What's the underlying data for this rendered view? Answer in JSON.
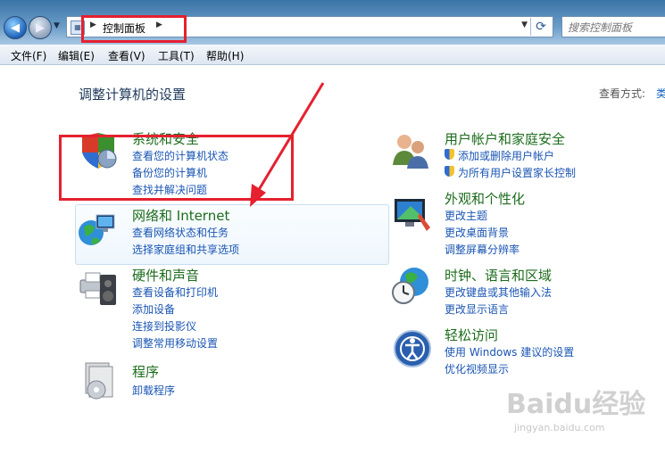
{
  "window": {
    "address_crumb": "控制面板",
    "search_placeholder": "搜索控制面板"
  },
  "menu": [
    "文件(F)",
    "编辑(E)",
    "查看(V)",
    "工具(T)",
    "帮助(H)"
  ],
  "page": {
    "title": "调整计算机的设置",
    "view_label": "查看方式:",
    "view_value": "类"
  },
  "categories": {
    "system_security": {
      "title": "系统和安全",
      "links": [
        "查看您的计算机状态",
        "备份您的计算机",
        "查找并解决问题"
      ]
    },
    "network": {
      "title": "网络和 Internet",
      "links": [
        "查看网络状态和任务",
        "选择家庭组和共享选项"
      ]
    },
    "hardware": {
      "title": "硬件和声音",
      "links": [
        "查看设备和打印机",
        "添加设备",
        "连接到投影仪",
        "调整常用移动设置"
      ]
    },
    "programs": {
      "title": "程序",
      "links": [
        "卸载程序"
      ]
    },
    "user_accounts": {
      "title": "用户帐户和家庭安全",
      "links": [
        "添加或删除用户帐户",
        "为所有用户设置家长控制"
      ]
    },
    "appearance": {
      "title": "外观和个性化",
      "links": [
        "更改主题",
        "更改桌面背景",
        "调整屏幕分辨率"
      ]
    },
    "clock_region": {
      "title": "时钟、语言和区域",
      "links": [
        "更改键盘或其他输入法",
        "更改显示语言"
      ]
    },
    "ease_access": {
      "title": "轻松访问",
      "links": [
        "使用 Windows 建议的设置",
        "优化视频显示"
      ]
    }
  },
  "watermark": {
    "brand": "Baidu经验",
    "url": "jingyan.baidu.com"
  },
  "colors": {
    "category_title": "#1c6c1c",
    "link": "#1a55b3",
    "highlight_box": "#e5202f"
  }
}
